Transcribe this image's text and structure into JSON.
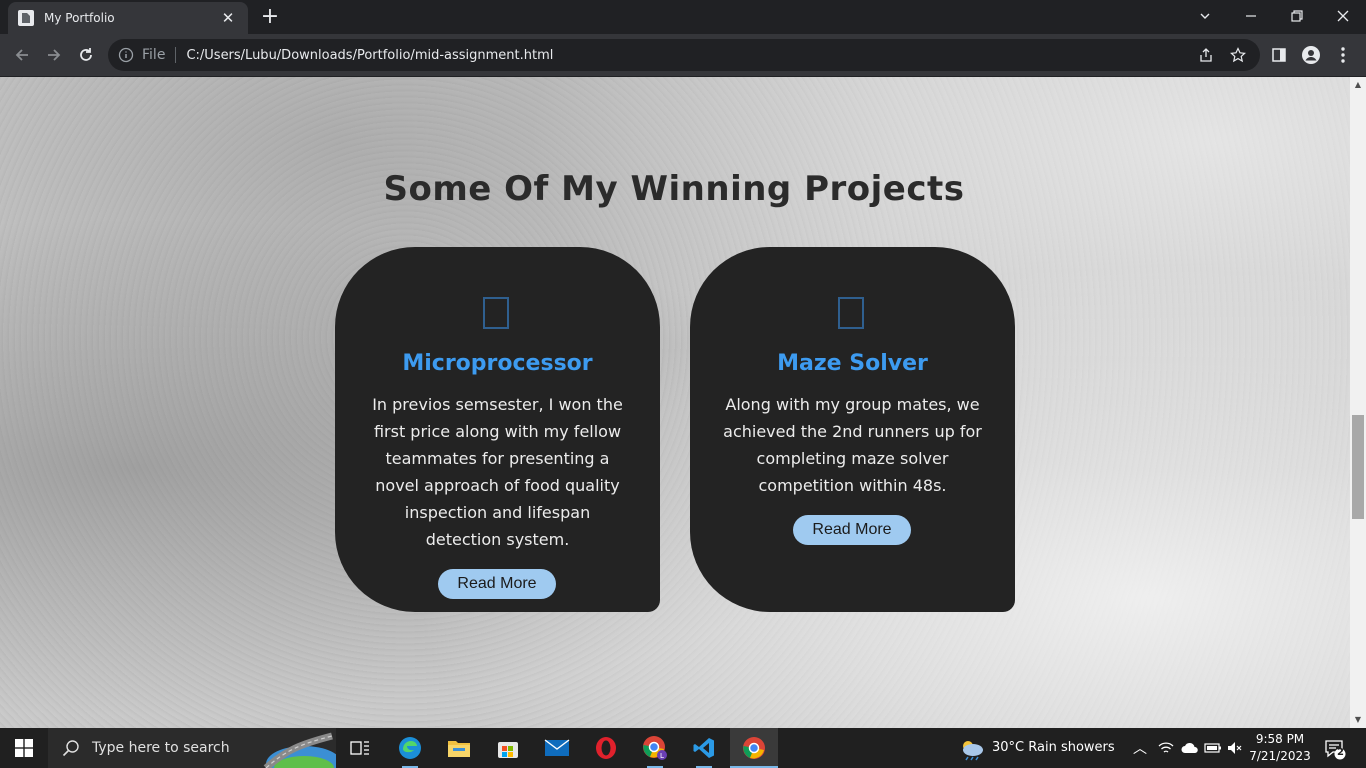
{
  "browser": {
    "tab_title": "My Portfolio",
    "new_tab_label": "+",
    "scheme_label": "File",
    "url": "C:/Users/Lubu/Downloads/Portfolio/mid-assignment.html"
  },
  "page": {
    "section_title": "Some Of My Winning Projects",
    "cards": [
      {
        "icon": "placeholder-glyph-icon",
        "title": "Microprocessor",
        "text": "In previos semsester, I won the first price along with my fellow teammates for presenting a novel approach of food quality inspection and lifespan detection system.",
        "button": "Read More"
      },
      {
        "icon": "placeholder-glyph-icon",
        "title": "Maze Solver",
        "text": "Along with my group mates, we achieved the 2nd runners up for completing maze solver competition within 48s.",
        "button": "Read More"
      }
    ]
  },
  "taskbar": {
    "search_placeholder": "Type here to search",
    "weather": "30°C  Rain showers",
    "time": "9:58 PM",
    "date": "7/21/2023",
    "notification_count": "2"
  },
  "colors": {
    "card_bg": "#232323",
    "card_title": "#3d9bf0",
    "button_bg": "#9fcaf0",
    "browser_bg": "#202124"
  }
}
